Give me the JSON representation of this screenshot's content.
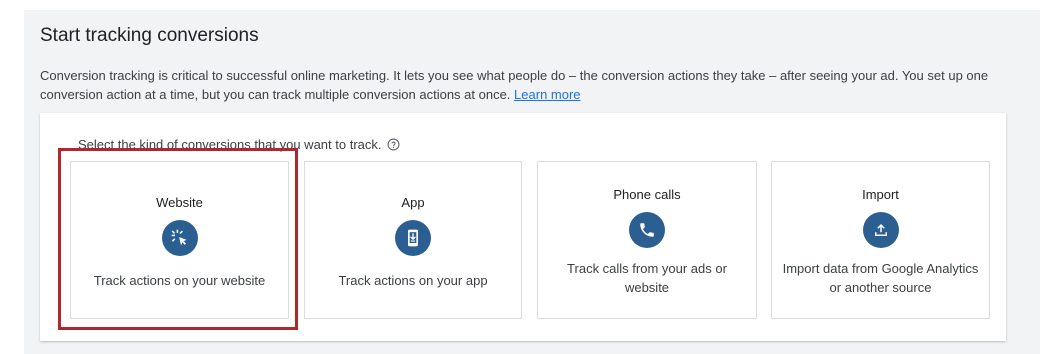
{
  "header": {
    "title": "Start tracking conversions",
    "description": "Conversion tracking is critical to successful online marketing. It lets you see what people do – the conversion actions they take – after seeing your ad. You set up one conversion action at a time, but you can track multiple conversion actions at once.",
    "learn_more": "Learn more"
  },
  "selector": {
    "prompt": "Select the kind of conversions that you want to track.",
    "help_icon": "help-circle-icon",
    "cards": [
      {
        "title": "Website",
        "icon": "cursor-click-icon",
        "text": "Track actions on your website",
        "selected": true
      },
      {
        "title": "App",
        "icon": "phone-download-icon",
        "text": "Track actions on your app",
        "selected": false
      },
      {
        "title": "Phone calls",
        "icon": "phone-icon",
        "text": "Track calls from your ads or website",
        "selected": false
      },
      {
        "title": "Import",
        "icon": "upload-icon",
        "text": "Import data from Google Analytics or another source",
        "selected": false
      }
    ]
  },
  "colors": {
    "icon_circle": "#2b5f91",
    "highlight": "#b0282c",
    "link": "#1a73e8"
  }
}
